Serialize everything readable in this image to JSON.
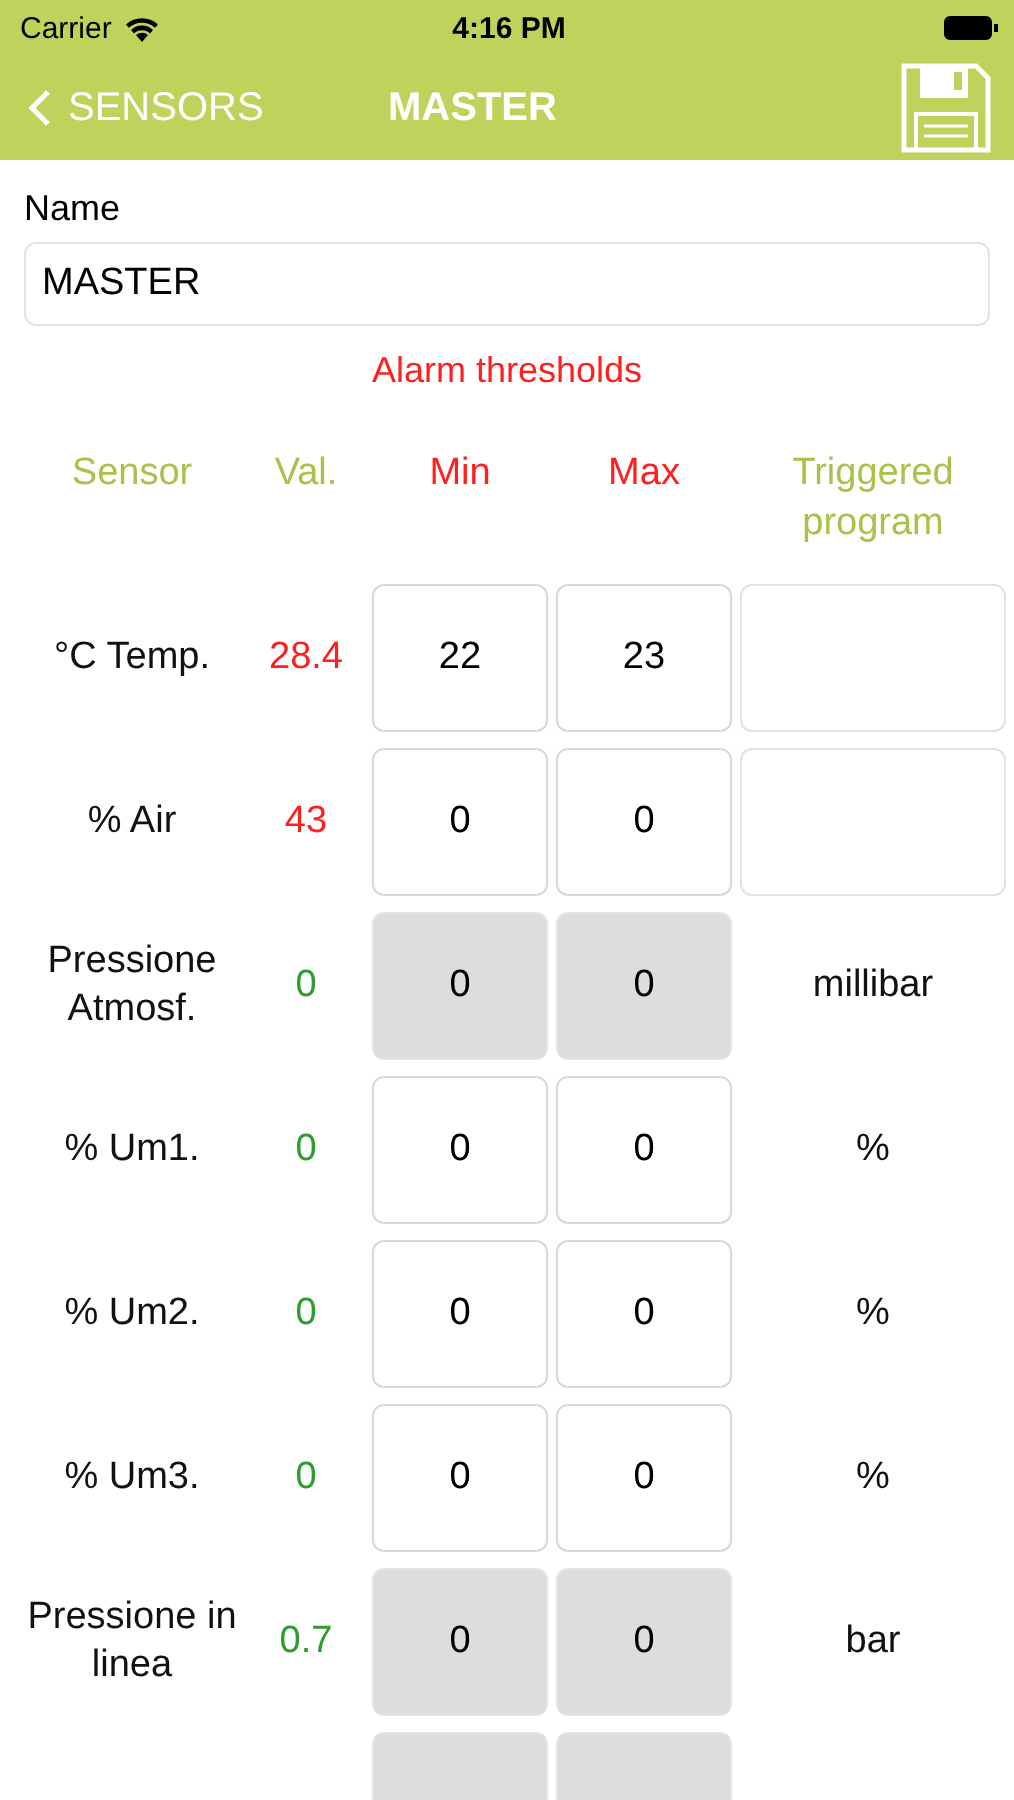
{
  "status_bar": {
    "carrier": "Carrier",
    "time": "4:16 PM"
  },
  "nav": {
    "back": "SENSORS",
    "title": "MASTER"
  },
  "name_field": {
    "label": "Name",
    "value": "MASTER"
  },
  "section_title": "Alarm thresholds",
  "columns": [
    {
      "label": "Sensor",
      "kind": "info"
    },
    {
      "label": "Val.",
      "kind": "info"
    },
    {
      "label": "Min",
      "kind": "alarm"
    },
    {
      "label": "Max",
      "kind": "alarm"
    },
    {
      "label": "Triggered program",
      "kind": "info"
    }
  ],
  "rows": [
    {
      "kind": "alarm",
      "sensor": "°C Temp.",
      "value": "28.4",
      "alarm": true,
      "min": "22",
      "max": "23",
      "disabled": false
    },
    {
      "kind": "alarm",
      "sensor": "% Air",
      "value": "43",
      "alarm": true,
      "min": "0",
      "max": "0",
      "disabled": false
    },
    {
      "kind": "measure",
      "sensor": "Pressione Atmosf.",
      "value": "0",
      "alarm": false,
      "min": "0",
      "max": "0",
      "disabled": true,
      "unit": "millibar"
    },
    {
      "kind": "measure",
      "sensor": "% Um1.",
      "value": "0",
      "alarm": false,
      "min": "0",
      "max": "0",
      "disabled": false,
      "unit": "%"
    },
    {
      "kind": "measure",
      "sensor": "% Um2.",
      "value": "0",
      "alarm": false,
      "min": "0",
      "max": "0",
      "disabled": false,
      "unit": "%"
    },
    {
      "kind": "measure",
      "sensor": "% Um3.",
      "value": "0",
      "alarm": false,
      "min": "0",
      "max": "0",
      "disabled": false,
      "unit": "%"
    },
    {
      "kind": "measure",
      "sensor": "Pressione in linea",
      "value": "0.7",
      "alarm": false,
      "min": "0",
      "max": "0",
      "disabled": true,
      "unit": "bar"
    },
    {
      "kind": "cut",
      "disabled": true
    }
  ]
}
